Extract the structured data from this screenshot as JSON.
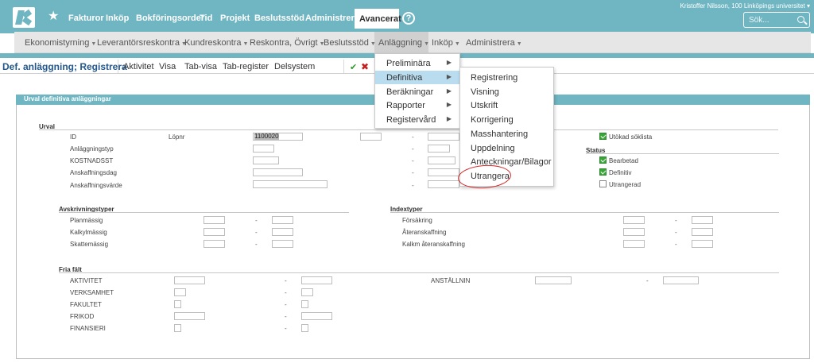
{
  "topbar": {
    "nav": [
      "Fakturor",
      "Inköp",
      "Bokföringsorder",
      "Tid",
      "Projekt",
      "Beslutsstöd",
      "Administrera"
    ],
    "active": "Avancerat",
    "user": "Kristoffer Nilsson, 100 Linköpings universitet",
    "search_placeholder": "Sök..."
  },
  "subnav": {
    "items": [
      "Ekonomistyrning",
      "Leverantörsreskontra",
      "Kundreskontra",
      "Reskontra, Övrigt",
      "Beslutsstöd",
      "Anläggning",
      "Inköp",
      "Administrera"
    ],
    "active": "Anläggning"
  },
  "toolbar": {
    "title": "Def. anläggning; Registrera",
    "items": [
      "Aktivitet",
      "Visa",
      "Tab-visa",
      "Tab-register",
      "Delsystem"
    ]
  },
  "panel": {
    "title": "Urval definitiva anläggningar",
    "urval": {
      "heading": "Urval",
      "id_label": "ID",
      "lopnr_label": "Löpnr",
      "lopnr_value": "1100020",
      "fields": [
        "Anläggningstyp",
        "KOSTNADSST",
        "Anskaffningsdag",
        "Anskaffningsvärde"
      ],
      "utokad": "Utökad söklista",
      "status_heading": "Status",
      "status": [
        {
          "label": "Bearbetad",
          "checked": true
        },
        {
          "label": "Definitiv",
          "checked": true
        },
        {
          "label": "Utrangerad",
          "checked": false
        }
      ]
    },
    "avskrivning": {
      "heading": "Avskrivningstyper",
      "fields": [
        "Planmässig",
        "Kalkylmässig",
        "Skattemässig"
      ]
    },
    "index": {
      "heading": "Indextyper",
      "fields": [
        "Försäkring",
        "Återanskaffning",
        "Kalkm återanskaffning"
      ]
    },
    "fria": {
      "heading": "Fria fält",
      "fields": [
        "AKTIVITET",
        "VERKSAMHET",
        "FAKULTET",
        "FRIKOD",
        "FINANSIERI"
      ],
      "right_field": "ANSTÄLLNIN"
    },
    "dash": "-"
  },
  "menu": {
    "level1": [
      "Preliminära",
      "Definitiva",
      "Beräkningar",
      "Rapporter",
      "Registervård"
    ],
    "selected": "Definitiva",
    "level2": [
      "Registrering",
      "Visning",
      "Utskrift",
      "Korrigering",
      "Masshantering",
      "Uppdelning",
      "Anteckningar/Bilagor",
      "Utrangera"
    ]
  },
  "colors": {
    "teal": "#6fb6c2",
    "title_blue": "#24588d",
    "highlight": "#b9dcef",
    "annotation_red": "#d42a2a"
  }
}
